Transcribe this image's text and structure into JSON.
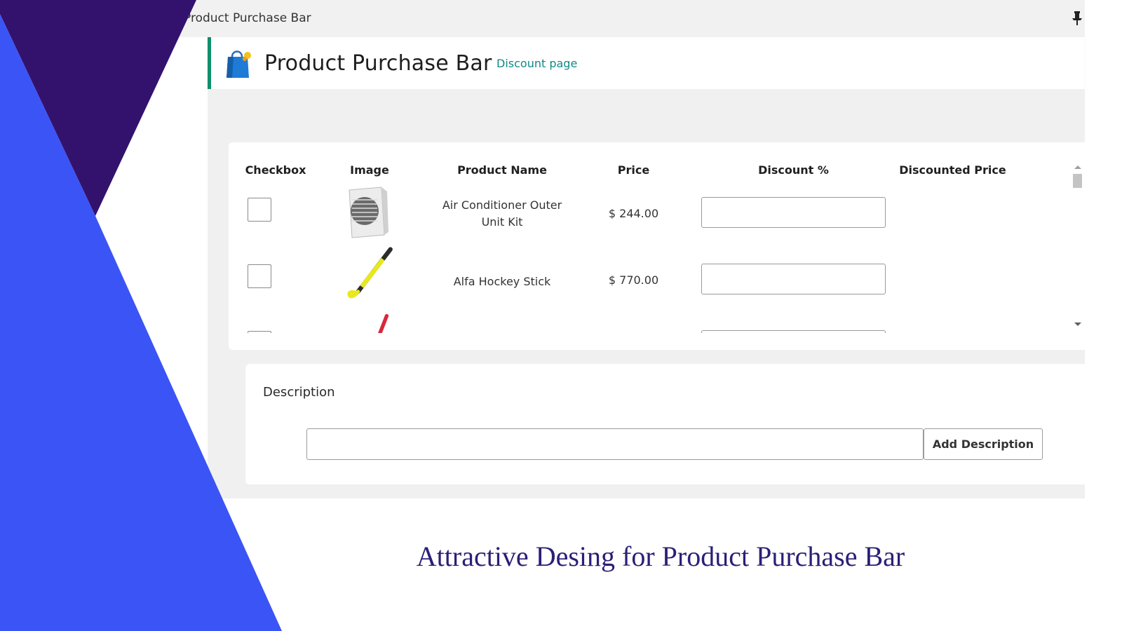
{
  "window": {
    "title": "Product Purchase Bar"
  },
  "header": {
    "title": "Product Purchase Bar",
    "discount_link": "Discount page"
  },
  "table": {
    "columns": [
      "Checkbox",
      "Image",
      "Product Name",
      "Price",
      "Discount %",
      "Discounted Price"
    ],
    "rows": [
      {
        "name": "Air Conditioner Outer Unit Kit",
        "price": "$ 244.00",
        "discount": "",
        "discounted_price": ""
      },
      {
        "name": "Alfa Hockey Stick",
        "price": "$ 770.00",
        "discount": "",
        "discounted_price": ""
      }
    ]
  },
  "description": {
    "label": "Description",
    "value": "",
    "button": "Add Description"
  },
  "caption": "Attractive Desing for Product Purchase Bar",
  "colors": {
    "accent": "#0f8f6c",
    "link": "#0f8a86",
    "deco_dark": "#33126e",
    "deco_blue": "#3b54f5",
    "caption": "#2a1f77"
  }
}
